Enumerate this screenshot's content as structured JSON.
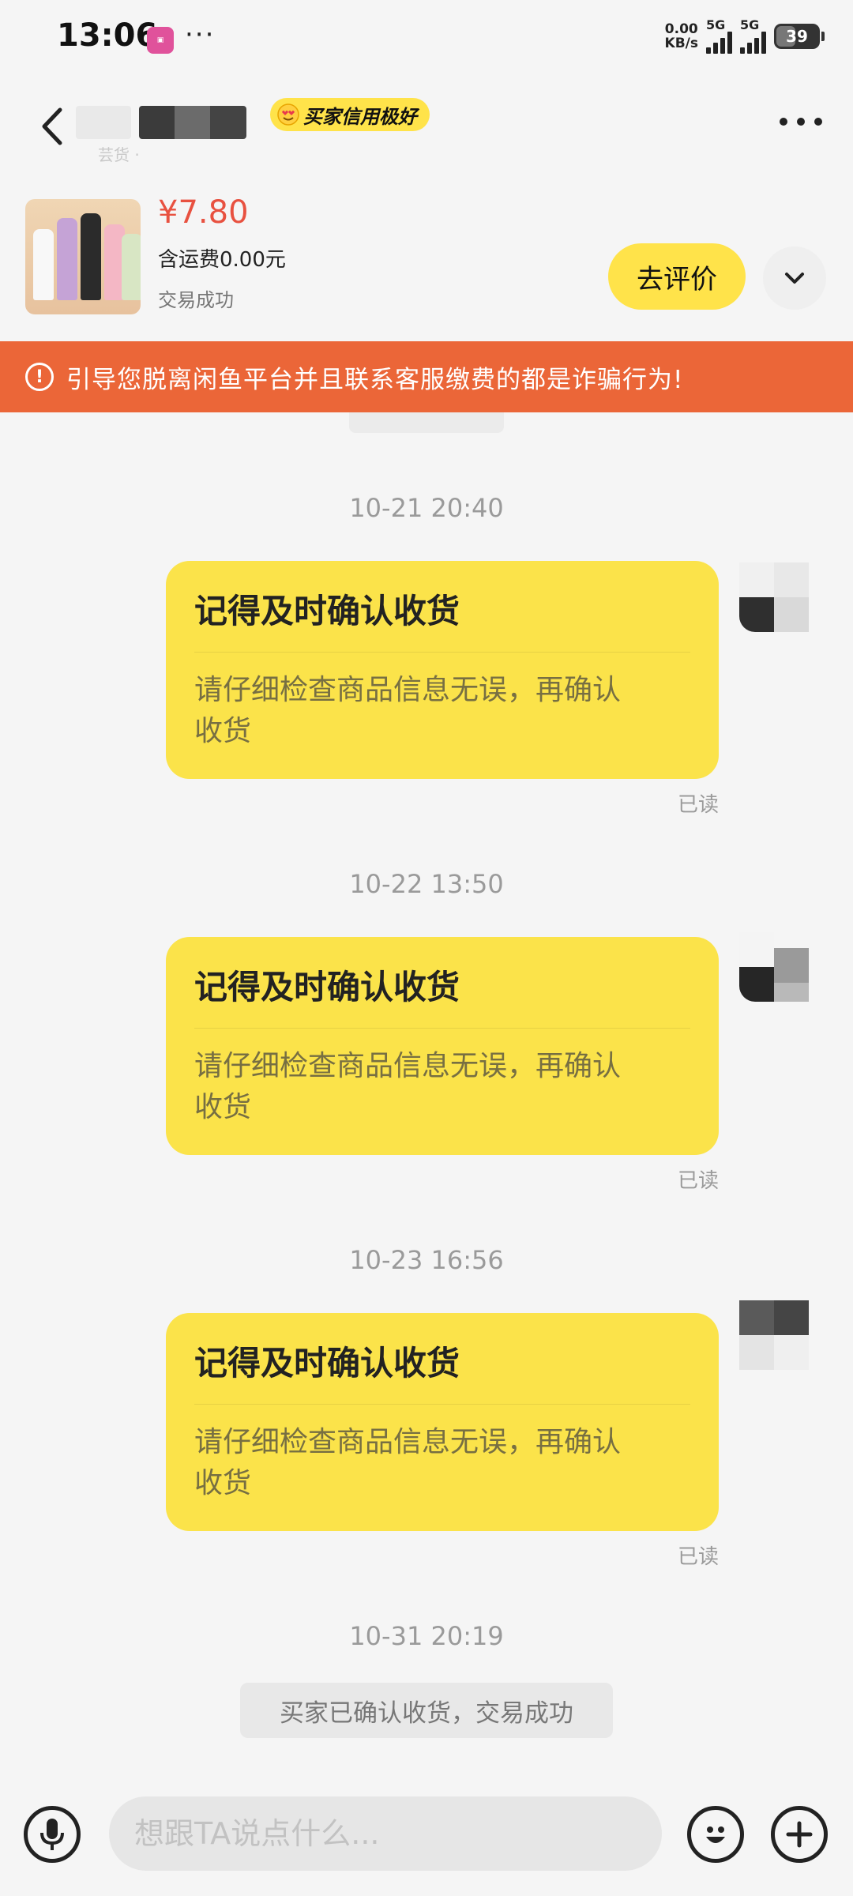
{
  "status_bar": {
    "time": "13:06",
    "dots": "···",
    "net_speed_value": "0.00",
    "net_speed_unit": "KB/s",
    "sig1_label": "5G",
    "sig2_label": "5G",
    "battery": "39"
  },
  "header": {
    "credit_badge": "买家信用极好",
    "sub_text": "芸货 ·"
  },
  "product": {
    "price": "¥7.80",
    "shipping": "含运费0.00元",
    "status": "交易成功",
    "review_button": "去评价"
  },
  "warning": {
    "text": "引导您脱离闲鱼平台并且联系客服缴费的都是诈骗行为!"
  },
  "messages": [
    {
      "timestamp": "10-21 20:40",
      "title": "记得及时确认收货",
      "body_line1": "请仔细检查商品信息无误，再确认",
      "body_line2": "收货",
      "read": "已读"
    },
    {
      "timestamp": "10-22 13:50",
      "title": "记得及时确认收货",
      "body_line1": "请仔细检查商品信息无误，再确认",
      "body_line2": "收货",
      "read": "已读"
    },
    {
      "timestamp": "10-23 16:56",
      "title": "记得及时确认收货",
      "body_line1": "请仔细检查商品信息无误，再确认",
      "body_line2": "收货",
      "read": "已读"
    }
  ],
  "final_timestamp": "10-31 20:19",
  "system_message": "买家已确认收货，交易成功",
  "input": {
    "placeholder": "想跟TA说点什么..."
  },
  "colors": {
    "accent_yellow": "#fbe34a",
    "warning_orange": "#eb6638",
    "price_red": "#e85140"
  }
}
